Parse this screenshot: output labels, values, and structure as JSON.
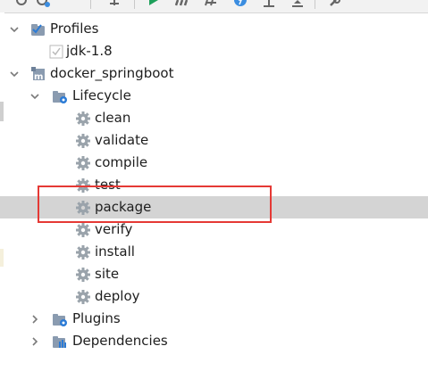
{
  "toolbar": {
    "icons": [
      "refresh-icon",
      "reimport-icon",
      "add-icon",
      "run-icon",
      "execute-goal-icon",
      "toggle-offline-icon",
      "skip-tests-icon",
      "show-dependencies-icon",
      "collapse-all-icon",
      "settings-wrench-icon"
    ]
  },
  "colors": {
    "selection": "#d4d4d4",
    "annotation": "#e53935",
    "arrow": "#7a7a7a",
    "folder": "#8a9bb0",
    "gear": "#9aa3ab",
    "run": "#1ea05b",
    "checkbox": "#b9b9b9"
  },
  "tree": {
    "profiles_label": "Profiles",
    "profile_item": "jdk-1.8",
    "project_label": "docker_springboot",
    "lifecycle_label": "Lifecycle",
    "phases": [
      "clean",
      "validate",
      "compile",
      "test",
      "package",
      "verify",
      "install",
      "site",
      "deploy"
    ],
    "selected_phase": "package",
    "plugins_label": "Plugins",
    "dependencies_label": "Dependencies"
  }
}
